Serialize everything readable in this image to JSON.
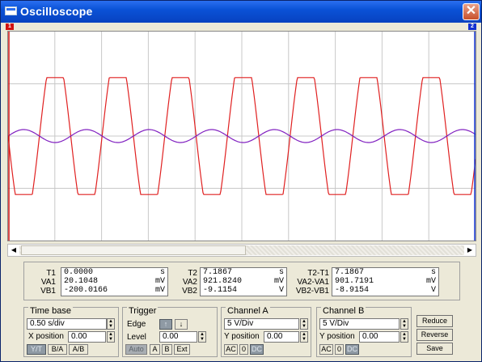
{
  "window": {
    "title": "Oscilloscope",
    "close_glyph": "✕"
  },
  "markers": {
    "cursor1": "1",
    "cursor2": "2"
  },
  "signals": {
    "channel_a_color": "#e02020",
    "channel_b_color": "#8020c0",
    "grid_color": "#c8c8c8"
  },
  "readout": {
    "t1": {
      "label": "T1",
      "value": "0.0000",
      "unit": "s"
    },
    "va1": {
      "label": "VA1",
      "value": "20.1048",
      "unit": "mV"
    },
    "vb1": {
      "label": "VB1",
      "value": "-200.0166",
      "unit": "mV"
    },
    "t2": {
      "label": "T2",
      "value": "7.1867",
      "unit": "s"
    },
    "va2": {
      "label": "VA2",
      "value": "921.8240",
      "unit": "mV"
    },
    "vb2": {
      "label": "VB2",
      "value": "-9.1154",
      "unit": "V"
    },
    "t2t1": {
      "label": "T2-T1",
      "value": "7.1867",
      "unit": "s"
    },
    "va2va1": {
      "label": "VA2-VA1",
      "value": "901.7191",
      "unit": "mV"
    },
    "vb2vb1": {
      "label": "VB2-VB1",
      "value": "-8.9154",
      "unit": "V"
    }
  },
  "timebase": {
    "title": "Time base",
    "scale": "0.50 s/div",
    "xpos_label": "X position",
    "xpos": "0.00",
    "yt": "Y/T",
    "ba": "B/A",
    "ab": "A/B"
  },
  "trigger": {
    "title": "Trigger",
    "edge_label": "Edge",
    "level_label": "Level",
    "level": "0.00",
    "auto": "Auto",
    "a": "A",
    "b": "B",
    "ext": "Ext"
  },
  "channel_a": {
    "title": "Channel A",
    "scale": "5 V/Div",
    "ypos_label": "Y position",
    "ypos": "0.00",
    "ac": "AC",
    "zero": "0",
    "dc": "DC"
  },
  "channel_b": {
    "title": "Channel B",
    "scale": "5 V/Div",
    "ypos_label": "Y position",
    "ypos": "0.00",
    "ac": "AC",
    "zero": "0",
    "dc": "DC"
  },
  "actions": {
    "reduce": "Reduce",
    "reverse": "Reverse",
    "save": "Save"
  }
}
